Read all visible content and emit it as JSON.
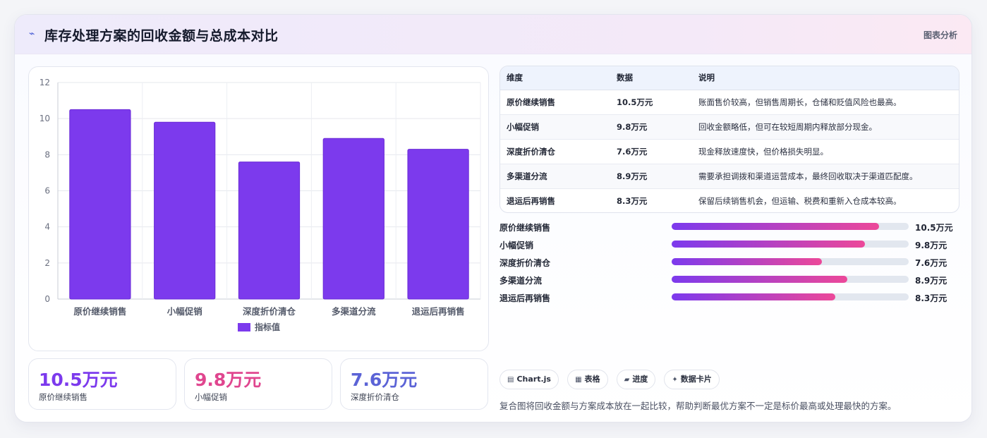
{
  "header": {
    "title": "库存处理方案的回收金额与总成本对比",
    "right_label": "图表分析"
  },
  "chart_data": {
    "type": "bar",
    "categories": [
      "原价继续销售",
      "小幅促销",
      "深度折价清仓",
      "多渠道分流",
      "退运后再销售"
    ],
    "series": [
      {
        "name": "指标值",
        "values": [
          10.5,
          9.8,
          7.6,
          8.9,
          8.3
        ],
        "color": "#7c3aed"
      }
    ],
    "ylim": [
      0,
      12
    ],
    "yticks": [
      0,
      2,
      4,
      6,
      8,
      10,
      12
    ],
    "grid": true,
    "legend": "bottom"
  },
  "stats": [
    {
      "value": "10.5万元",
      "label": "原价继续销售",
      "color": "#7c3aed"
    },
    {
      "value": "9.8万元",
      "label": "小幅促销",
      "color": "#e0468f"
    },
    {
      "value": "7.6万元",
      "label": "深度折价清仓",
      "color": "#5b63d6"
    }
  ],
  "table": {
    "headers": [
      "维度",
      "数据",
      "说明"
    ],
    "rows": [
      [
        "原价继续销售",
        "10.5万元",
        "账面售价较高，但销售周期长，仓储和贬值风险也最高。"
      ],
      [
        "小幅促销",
        "9.8万元",
        "回收金额略低，但可在较短周期内释放部分现金。"
      ],
      [
        "深度折价清仓",
        "7.6万元",
        "现金释放速度快，但价格损失明显。"
      ],
      [
        "多渠道分流",
        "8.9万元",
        "需要承担调拨和渠道运营成本，最终回收取决于渠道匹配度。"
      ],
      [
        "退运后再销售",
        "8.3万元",
        "保留后续销售机会，但运输、税费和重新入仓成本较高。"
      ]
    ]
  },
  "progress": {
    "max": 12,
    "items": [
      {
        "label": "原价继续销售",
        "value": 10.5,
        "text": "10.5万元"
      },
      {
        "label": "小幅促销",
        "value": 9.8,
        "text": "9.8万元"
      },
      {
        "label": "深度折价清仓",
        "value": 7.6,
        "text": "7.6万元"
      },
      {
        "label": "多渠道分流",
        "value": 8.9,
        "text": "8.9万元"
      },
      {
        "label": "退运后再销售",
        "value": 8.3,
        "text": "8.3万元"
      }
    ]
  },
  "tags": [
    {
      "icon": "chart-icon",
      "glyph": "▤",
      "label": "Chart.js"
    },
    {
      "icon": "table-icon",
      "glyph": "▦",
      "label": "表格"
    },
    {
      "icon": "progress-icon",
      "glyph": "▰",
      "label": "进度"
    },
    {
      "icon": "card-icon",
      "glyph": "✦",
      "label": "数据卡片"
    }
  ],
  "footnote": "复合图将回收金额与方案成本放在一起比较，帮助判断最优方案不一定是标价最高或处理最快的方案。"
}
